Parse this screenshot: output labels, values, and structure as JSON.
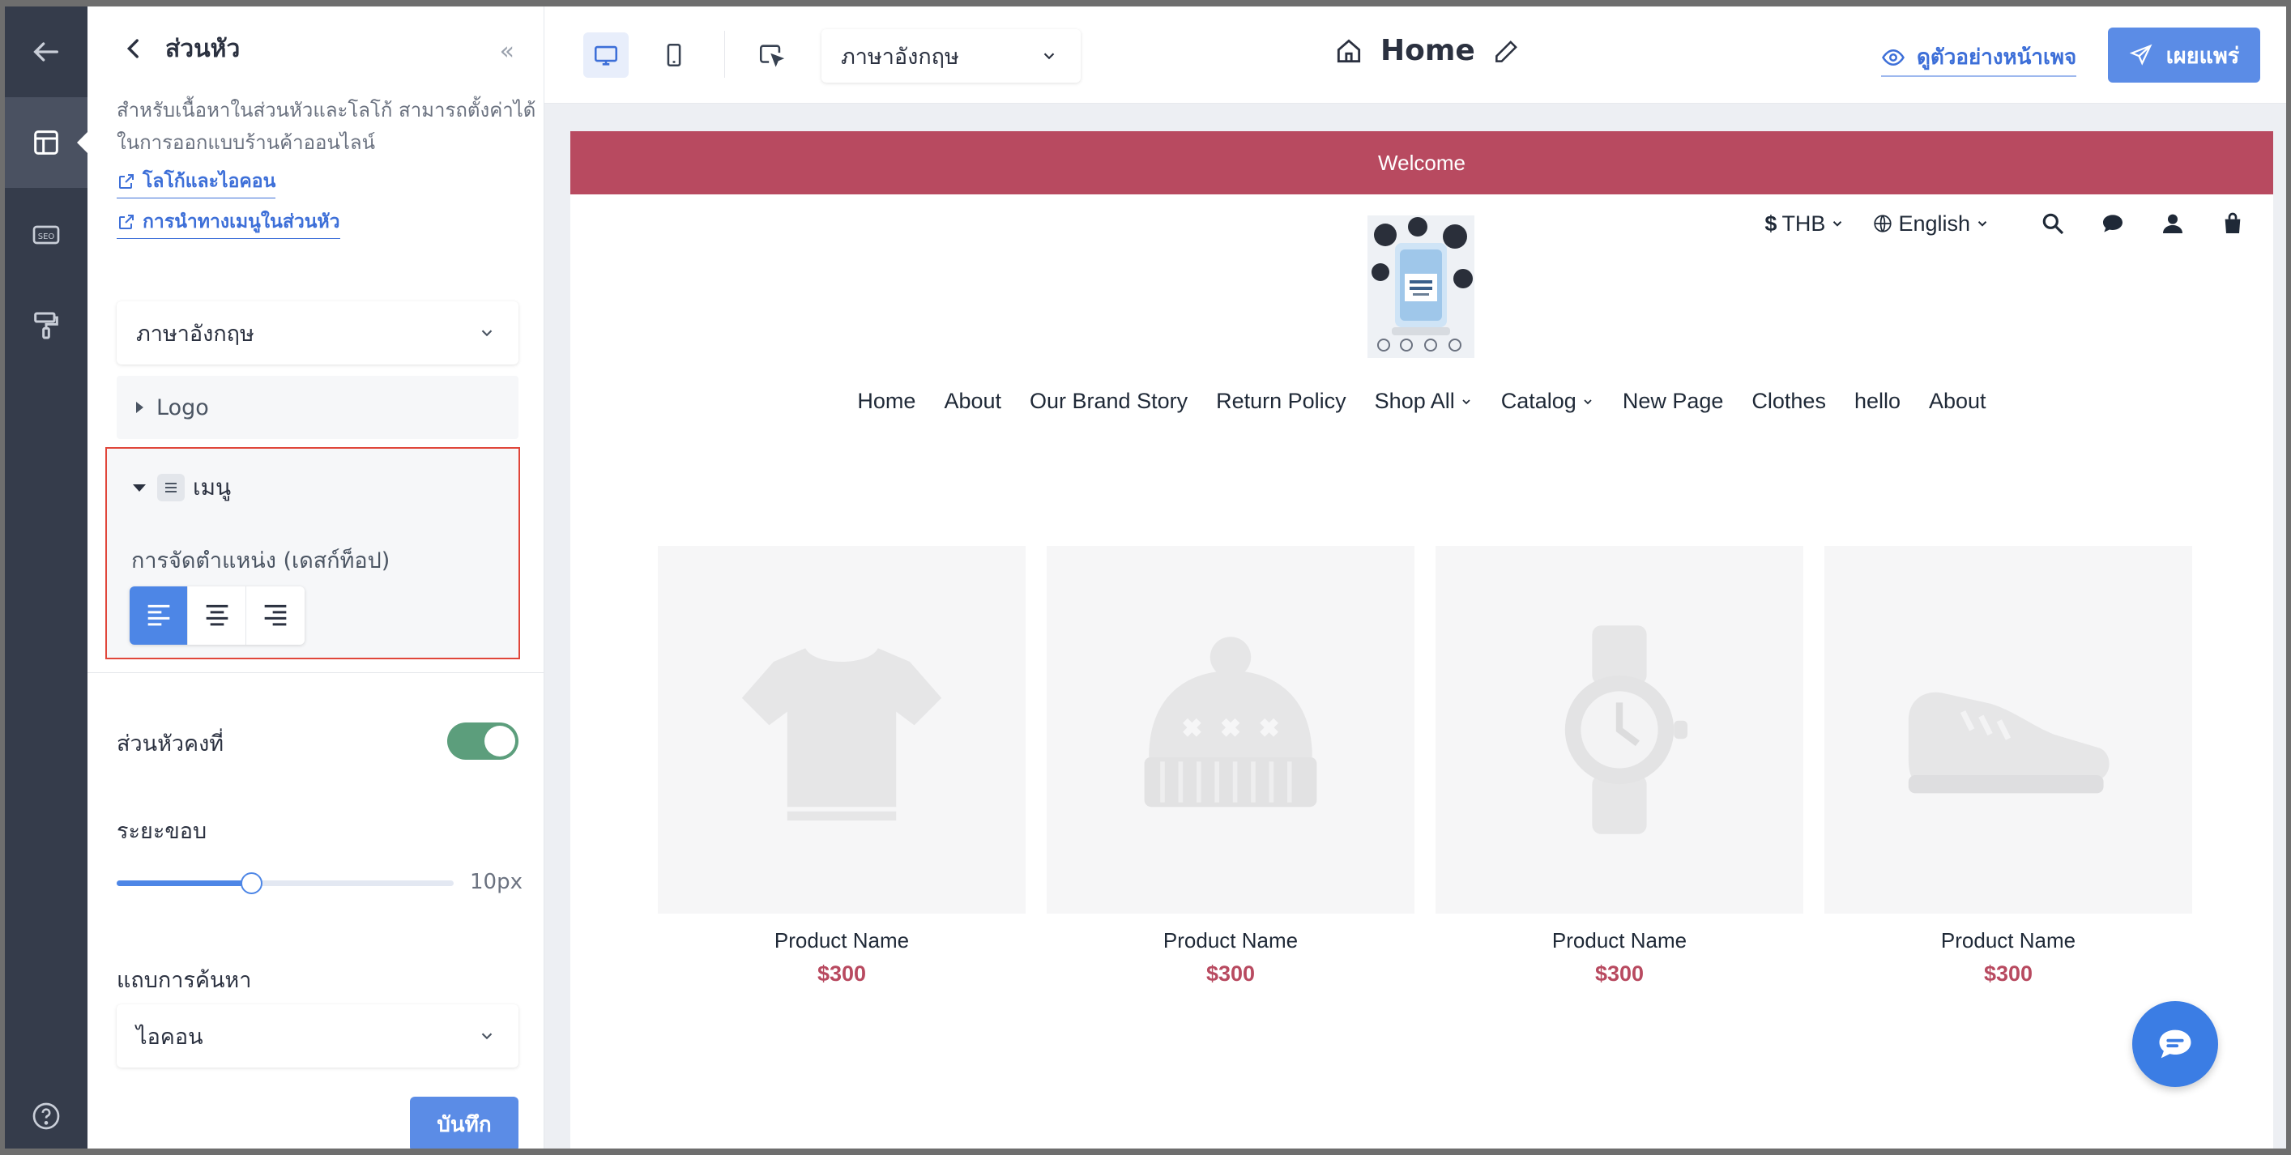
{
  "rail": {
    "items": [
      "back-arrow-icon",
      "layout-icon",
      "seo-icon",
      "paint-roller-icon",
      "help-icon"
    ],
    "seo_text": "SEO"
  },
  "panel": {
    "title": "ส่วนหัว",
    "description": "สำหรับเนื้อหาในส่วนหัวและโลโก้ สามารถตั้งค่าได้ในการออกแบบร้านค้าออนไลน์",
    "link_logo": "โลโก้และไอคอน",
    "link_menu": "การนำทางเมนูในส่วนหัว",
    "language_select": "ภาษาอังกฤษ",
    "logo_section": "Logo",
    "menu_section": "เมนู",
    "align_label": "การจัดตำแหน่ง (เดสก์ท็อป)",
    "align_selected": "left",
    "sticky_label": "ส่วนหัวคงที่",
    "sticky_on": true,
    "padding_label": "ระยะขอบ",
    "padding_value": "10px",
    "padding_fraction": 0.4,
    "search_label": "แถบการค้นหา",
    "search_select": "ไอคอน",
    "save_label": "บันทึก"
  },
  "topbar": {
    "device": "desktop",
    "language_select": "ภาษาอังกฤษ",
    "page_name": "Home",
    "preview_label": "ดูตัวอย่างหน้าเพจ",
    "publish_label": "เผยแพร่",
    "accent": "#5b8ce6"
  },
  "site": {
    "welcome": "Welcome",
    "banner_color": "#b84a60",
    "currency": "THB",
    "language": "English",
    "nav": [
      "Home",
      "About",
      "Our Brand Story",
      "Return Policy",
      "Shop All",
      "Catalog",
      "New Page",
      "Clothes",
      "hello",
      "About"
    ],
    "products": [
      {
        "name": "Product Name",
        "price": "$300",
        "icon": "tshirt-icon"
      },
      {
        "name": "Product Name",
        "price": "$300",
        "icon": "beanie-icon"
      },
      {
        "name": "Product Name",
        "price": "$300",
        "icon": "watch-icon"
      },
      {
        "name": "Product Name",
        "price": "$300",
        "icon": "sneaker-icon"
      }
    ]
  }
}
